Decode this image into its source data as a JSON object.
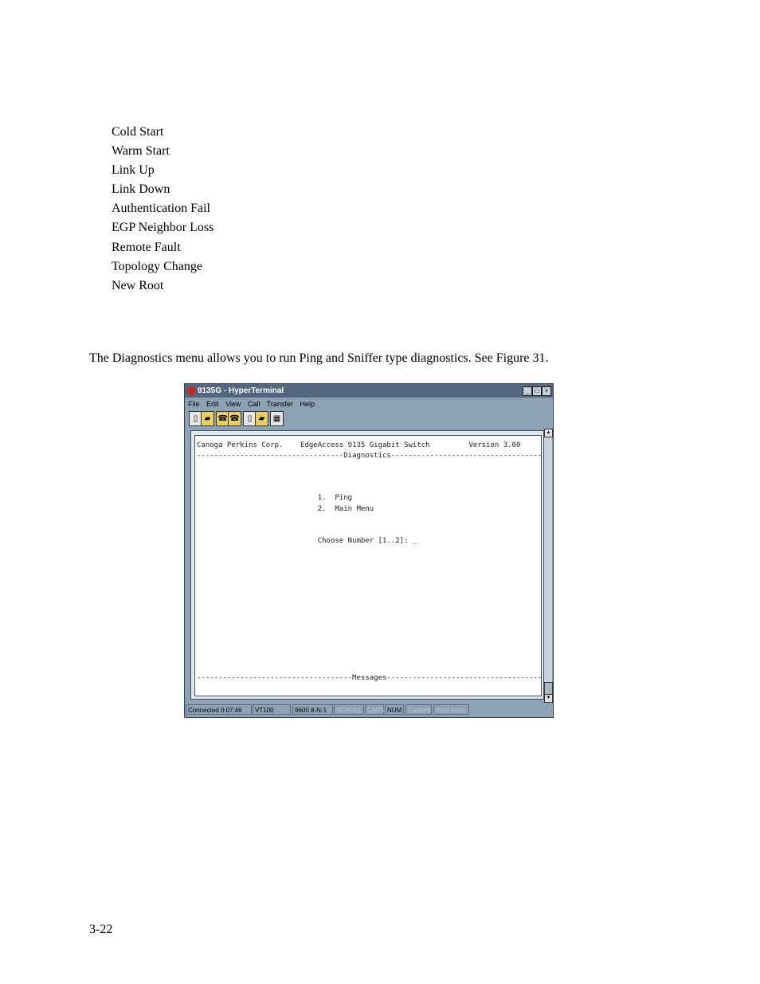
{
  "list": [
    "Cold Start",
    "Warm Start",
    "Link Up",
    "Link Down",
    "Authentication Fail",
    "EGP Neighbor Loss",
    "Remote Fault",
    "Topology Change",
    "New Root"
  ],
  "paragraph": "The Diagnostics menu allows you to run Ping and Sniffer type diagnostics. See Figure 31.",
  "page_number": "3-22",
  "window": {
    "title": "9135G - HyperTerminal",
    "menu": [
      "File",
      "Edit",
      "View",
      "Call",
      "Transfer",
      "Help"
    ],
    "toolbar_icons": [
      "new-icon",
      "open-icon",
      "connect-icon",
      "disconnect-icon",
      "send-icon",
      "receive-icon",
      "properties-icon"
    ],
    "terminal": {
      "header": "Canoga Perkins Corp.    EdgeAccess 9135 Gigabit Switch         Version 3.00",
      "divider": "----------------------------------Diagnostics-----------------------------------",
      "option1": "                            1.  Ping",
      "option2": "                            2.  Main Menu",
      "prompt": "                            Choose Number [1..2]: _",
      "messages": "------------------------------------Messages------------------------------------"
    },
    "status": {
      "connected": "Connected 0:07:46",
      "emulation": "VT100",
      "settings": "9600 8-N-1",
      "scroll": "SCROLL",
      "caps": "CAPS",
      "num": "NUM",
      "capture": "Capture",
      "print_echo": "Print echo"
    }
  }
}
